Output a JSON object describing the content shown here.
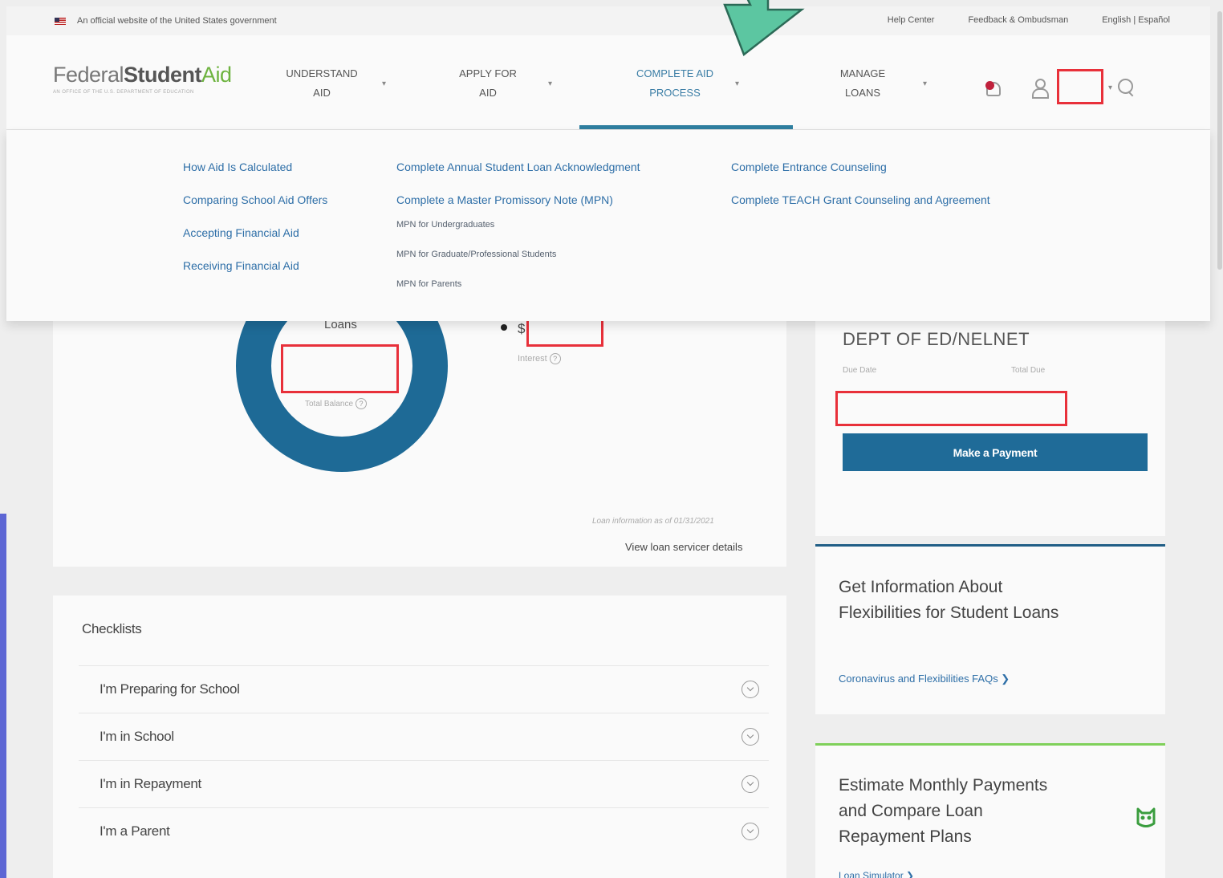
{
  "gov_banner": {
    "text": "An official website of the United States government",
    "links": [
      "Help Center",
      "Feedback & Ombudsman",
      "English | Español"
    ]
  },
  "header": {
    "logo": {
      "part1": "Federal",
      "part2": "Student",
      "part3": "Aid",
      "tagline": "AN OFFICE OF THE U.S. DEPARTMENT OF EDUCATION"
    },
    "nav": [
      {
        "label": "UNDERSTAND\nAID"
      },
      {
        "label": "APPLY FOR\nAID"
      },
      {
        "label": "COMPLETE AID\nPROCESS"
      },
      {
        "label": "MANAGE\nLOANS"
      }
    ],
    "icons": [
      "bell-icon",
      "user-icon",
      "search-icon"
    ]
  },
  "dropdown": {
    "col1": [
      "How Aid Is Calculated",
      "Comparing School Aid Offers",
      "Accepting Financial Aid",
      "Receiving Financial Aid"
    ],
    "col2": {
      "links": [
        "Complete Annual Student Loan Acknowledgment",
        "Complete a Master Promissory Note (MPN)"
      ],
      "sub": [
        "MPN for Undergraduates",
        "MPN for Graduate/Professional Students",
        "MPN for Parents"
      ]
    },
    "col3": [
      "Complete Entrance Counseling",
      "Complete TEACH Grant Counseling and Agreement"
    ]
  },
  "loan_summary": {
    "donut_label": "Loans",
    "donut_caption": "Total Balance",
    "legend_currency": "$",
    "legend_caption": "Interest",
    "as_of": "Loan information as of 01/31/2021",
    "view_servicer": "View loan servicer details"
  },
  "servicer": {
    "name": "DEPT OF ED/NELNET",
    "due_date_label": "Due Date",
    "total_due_label": "Total Due",
    "pay_button": "Make a Payment"
  },
  "flexibilities": {
    "title": "Get Information About Flexibilities for Student Loans",
    "link": "Coronavirus and Flexibilities FAQs ❯"
  },
  "estimate": {
    "title": "Estimate Monthly Payments and Compare Loan Repayment Plans",
    "link": "Loan Simulator ❯"
  },
  "checklists": {
    "title": "Checklists",
    "items": [
      "I'm Preparing for School",
      "I'm in School",
      "I'm in Repayment",
      "I'm a Parent"
    ]
  },
  "colors": {
    "accent_blue": "#1f6b98",
    "annotation_red": "#e8303a",
    "annotation_green": "#5cc6a1",
    "annotation_purple": "#5d66d4"
  }
}
